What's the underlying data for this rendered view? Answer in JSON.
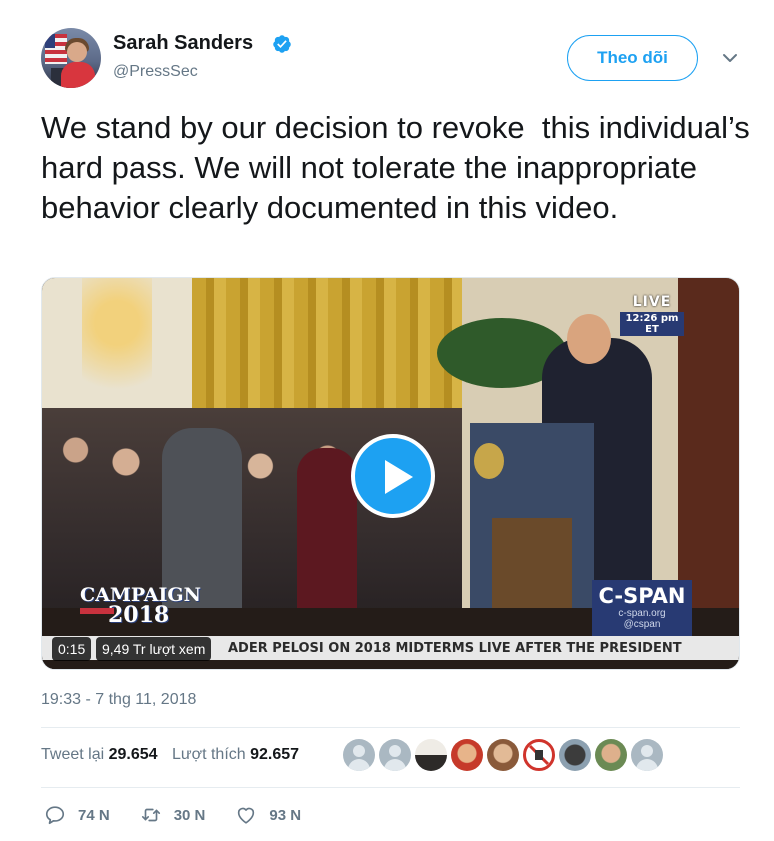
{
  "author": {
    "name": "Sarah Sanders",
    "handle": "@PressSec",
    "verified": true
  },
  "follow_button": {
    "label": "Theo dõi"
  },
  "tweet": {
    "text": "We stand by our decision to revoke  this individual’s hard pass. We will not tolerate the inappropriate behavior clearly documented in this video."
  },
  "video": {
    "live_label": "LIVE",
    "live_time": "12:26 pm ET",
    "campaign_line1": "CAMPAIGN",
    "campaign_line2": "2018",
    "cspan_name": "C-SPAN",
    "cspan_url": "c-span.org",
    "cspan_handle": "@cspan",
    "ticker": "ADER PELOSI ON 2018 MIDTERMS LIVE AFTER THE PRESIDENT",
    "duration": "0:15",
    "views": "9,49 Tr lượt xem"
  },
  "timestamp": "19:33 - 7 thg 11, 2018",
  "stats": {
    "retweets_label": "Tweet lại",
    "retweets_value": "29.654",
    "likes_label": "Lượt thích",
    "likes_value": "92.657"
  },
  "liker_avatars": [
    "default",
    "default",
    "photo",
    "photo",
    "photo",
    "photo",
    "photo",
    "photo",
    "default"
  ],
  "actions": {
    "replies": "74 N",
    "retweets": "30 N",
    "likes": "93 N"
  },
  "colors": {
    "accent": "#1da1f2",
    "text_primary": "#14171a",
    "text_secondary": "#657786",
    "divider": "#e6ecf0"
  }
}
